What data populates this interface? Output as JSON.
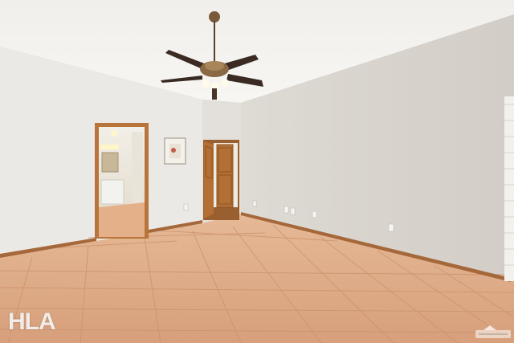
{
  "scene": {
    "type": "photo",
    "subject": "empty-room",
    "colors": {
      "ceiling": "#f4f2ef",
      "wall_left": "#ebe9e5",
      "wall_right": "#d8d4cf",
      "wall_back": "#e3e0db",
      "floor_tile": "#dba883",
      "grout": "#c9906a",
      "baseboard": "#a5683b",
      "door_wood": "#b8743a",
      "fan_blade": "#3a2a22",
      "fan_brass": "#8a6a45"
    }
  },
  "watermark": {
    "logo_text": "HLA"
  }
}
